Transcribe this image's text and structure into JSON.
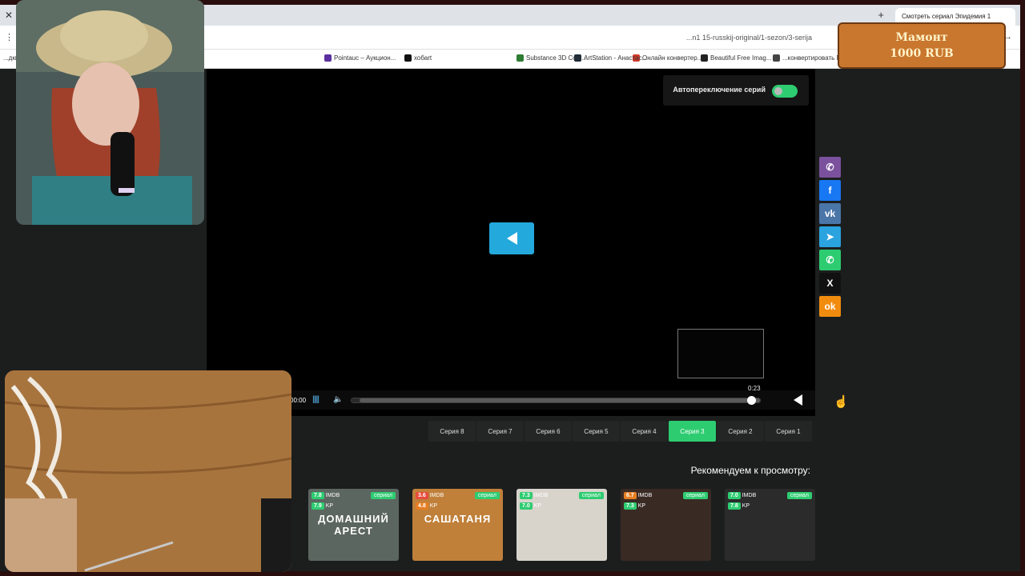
{
  "browser": {
    "tab_title": "Смотреть сериал Эпидемия 1",
    "tab_close": "✕",
    "new_tab": "+",
    "window_close": "✕",
    "url": "...n1 15-russkij-original/1-sezon/3-serija",
    "addr_left": "⋮",
    "addr_right": "→"
  },
  "bookmarks": [
    {
      "label": "...конвертировать М...",
      "color": "#444444"
    },
    {
      "label": "Beautiful Free Imag...",
      "color": "#222222"
    },
    {
      "label": "Онлайн конвертер...",
      "color": "#d33a2c"
    },
    {
      "label": "ArtStation - Анастас...",
      "color": "#1c2b3a"
    },
    {
      "label": "Substance 3D Com...",
      "color": "#2e7d32"
    },
    {
      "label": "хобаrt",
      "color": "#111111"
    },
    {
      "label": "Pointauc – Аукцион...",
      "color": "#5b2fa0"
    }
  ],
  "bookmarks_left": "...дки",
  "player": {
    "autoplay_label": "Автопереключение серий",
    "time_tooltip": "0:23",
    "current_time": "00:00",
    "volume_bars": "|||||",
    "volume_icon": "🔈",
    "progress_fraction": 0.98
  },
  "episodes": [
    {
      "label": "Серия 1",
      "active": false
    },
    {
      "label": "Серия 2",
      "active": false
    },
    {
      "label": "Серия 3",
      "active": true
    },
    {
      "label": "Серия 4",
      "active": false
    },
    {
      "label": "Серия 5",
      "active": false
    },
    {
      "label": "Серия 6",
      "active": false
    },
    {
      "label": "Серия 7",
      "active": false
    },
    {
      "label": "Серия 8",
      "active": false
    }
  ],
  "recommended_title": "Рекомендуем к просмотру:",
  "cards": [
    {
      "genre": "сериал",
      "imdb": "7.0",
      "imdb_color": "#2ecc71",
      "kp": "7.8",
      "kp_color": "#2ecc71",
      "poster": "",
      "bg": "#2b2b2b"
    },
    {
      "genre": "сериал",
      "imdb": "6.7",
      "imdb_color": "#e67e22",
      "kp": "7.3",
      "kp_color": "#2ecc71",
      "poster": "",
      "bg": "#3a2a24"
    },
    {
      "genre": "сериал",
      "imdb": "7.3",
      "imdb_color": "#2ecc71",
      "kp": "7.0",
      "kp_color": "#2ecc71",
      "poster": "",
      "bg": "#d8d4cc"
    },
    {
      "genre": "сериал",
      "imdb": "3.6",
      "imdb_color": "#e74c3c",
      "kp": "4.8",
      "kp_color": "#e67e22",
      "poster": "САШАТАНЯ",
      "bg": "#c0803a"
    },
    {
      "genre": "сериал",
      "imdb": "7.8",
      "imdb_color": "#2ecc71",
      "kp": "7.9",
      "kp_color": "#2ecc71",
      "poster": "ДОМАШНИЙ АРЕСТ",
      "bg": "#5c6660"
    }
  ],
  "share": [
    {
      "icon": "viber-icon",
      "glyph": "✆",
      "color": "#7b519d"
    },
    {
      "icon": "facebook-icon",
      "glyph": "f",
      "color": "#1877f2"
    },
    {
      "icon": "vk-icon",
      "glyph": "vk",
      "color": "#4a76a8"
    },
    {
      "icon": "telegram-icon",
      "glyph": "➤",
      "color": "#2aa3df"
    },
    {
      "icon": "whatsapp-icon",
      "glyph": "✆",
      "color": "#2ecc71"
    },
    {
      "icon": "x-icon",
      "glyph": "X",
      "color": "#111111"
    },
    {
      "icon": "odnoklassniki-icon",
      "glyph": "ok",
      "color": "#f28c0f"
    }
  ],
  "donation": {
    "line1": "Мамонт",
    "line2": "1000 RUB"
  }
}
